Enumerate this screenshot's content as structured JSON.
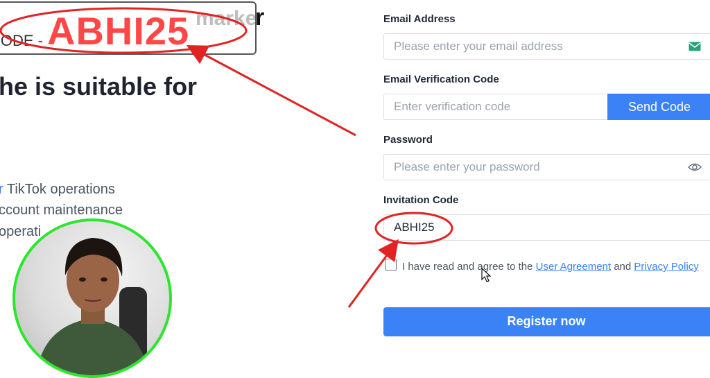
{
  "promo": {
    "ghost_text": "marketers the code for",
    "trailing_char": "r",
    "label": "CODE -",
    "code": "ABHI25"
  },
  "left": {
    "headline": "he is suitable for",
    "features": [
      {
        "accent": "r",
        "text": " TikTok operations"
      },
      {
        "accent": "",
        "text": "ccount maintenance"
      },
      {
        "accent": "",
        "text": "operati"
      }
    ]
  },
  "form": {
    "email": {
      "label": "Email Address",
      "placeholder": "Please enter your email address"
    },
    "verification": {
      "label": "Email Verification Code",
      "placeholder": "Enter verification code",
      "button": "Send Code"
    },
    "password": {
      "label": "Password",
      "placeholder": "Please enter your password"
    },
    "invitation": {
      "label": "Invitation Code",
      "value": "ABHI25"
    },
    "agreement": {
      "prefix": "I have read and agree to the ",
      "user_agreement": "User Agreement",
      "conjunction": " and ",
      "privacy_policy": "Privacy Policy",
      "checked": false
    },
    "register_button": "Register now"
  },
  "colors": {
    "primary": "#3b82f6",
    "annotation_red": "#e02424",
    "webcam_ring": "#2ee62e",
    "promo_code": "#ff4747"
  },
  "icons": {
    "email": "email-icon",
    "password_toggle": "eye-icon"
  }
}
